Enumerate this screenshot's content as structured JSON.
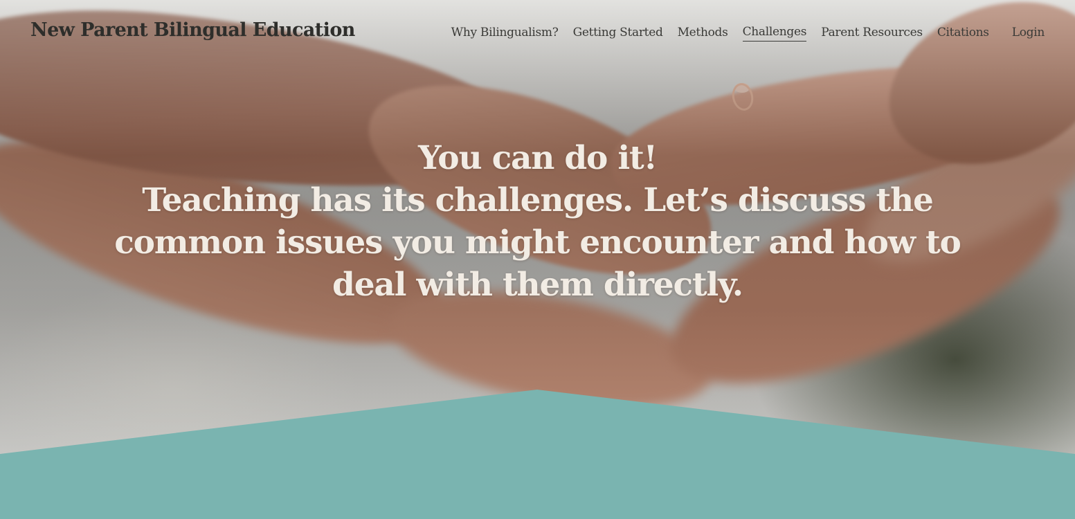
{
  "site": {
    "title": "New Parent Bilingual Education"
  },
  "nav": {
    "items": [
      {
        "label": "Why Bilingualism?",
        "active": false
      },
      {
        "label": "Getting Started",
        "active": false
      },
      {
        "label": "Methods",
        "active": false
      },
      {
        "label": "Challenges",
        "active": true
      },
      {
        "label": "Parent Resources",
        "active": false
      },
      {
        "label": "Citations",
        "active": false
      }
    ],
    "login_label": "Login"
  },
  "hero": {
    "heading_line1": "You can do it!",
    "heading_line2": "Teaching has its challenges. Let’s discuss the common issues you might encounter and how to deal with them directly."
  },
  "colors": {
    "accent_teal": "#7ab4b0",
    "hero_text": "#f2ece4",
    "header_text": "#2e2e2b"
  }
}
